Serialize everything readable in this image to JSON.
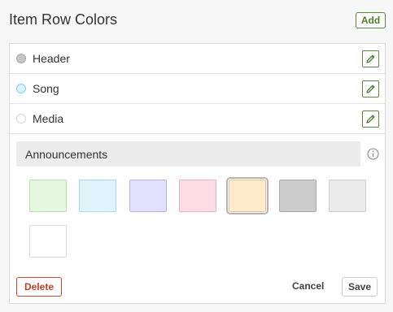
{
  "header": {
    "title": "Item Row Colors",
    "add_label": "Add"
  },
  "rows": [
    {
      "label": "Header",
      "color": "#c6c6c6",
      "border": "#a8a8a8"
    },
    {
      "label": "Song",
      "color": "#ddf3fb",
      "border": "#7fd0e8"
    },
    {
      "label": "Media",
      "color": "#ffffff",
      "border": "#d4d4d4"
    }
  ],
  "editor": {
    "name_value": "Announcements",
    "swatches": [
      {
        "color": "#e4f7df",
        "border": "#b8e0ab",
        "selected": false
      },
      {
        "color": "#dff3fb",
        "border": "#a9dcee",
        "selected": false
      },
      {
        "color": "#e2dfff",
        "border": "#b8b1ee",
        "selected": false
      },
      {
        "color": "#fddde5",
        "border": "#ecb0c0",
        "selected": false
      },
      {
        "color": "#ffebcc",
        "border": "#e6c896",
        "selected": true
      },
      {
        "color": "#cdcdcd",
        "border": "#aaaaaa",
        "selected": false
      },
      {
        "color": "#ebebeb",
        "border": "#cfcfcf",
        "selected": false
      },
      {
        "color": "#ffffff",
        "border": "#dcdcdc",
        "selected": false
      }
    ],
    "delete_label": "Delete",
    "cancel_label": "Cancel",
    "save_label": "Save"
  },
  "colors": {
    "accent_green": "#5a8a3c",
    "danger_red": "#d0442f"
  }
}
